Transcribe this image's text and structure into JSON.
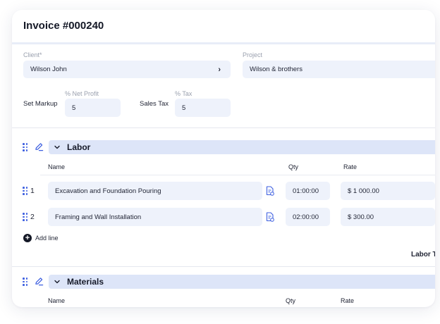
{
  "invoice": {
    "title": "Invoice #000240"
  },
  "client": {
    "label": "Client*",
    "value": "Wilson John"
  },
  "project": {
    "label": "Project",
    "value": "Wilson & brothers"
  },
  "markup": {
    "label": "Set Markup",
    "net_profit_label": "% Net Profit",
    "net_profit_value": "5"
  },
  "tax": {
    "label": "Sales Tax",
    "tax_label": "% Tax",
    "tax_value": "5"
  },
  "labor": {
    "title": "Labor",
    "columns": {
      "name": "Name",
      "qty": "Qty",
      "rate": "Rate"
    },
    "rows": [
      {
        "num": "1",
        "name": "Excavation and Foundation Pouring",
        "qty": "01:00:00",
        "rate": "$ 1 000.00"
      },
      {
        "num": "2",
        "name": "Framing and Wall Installation",
        "qty": "02:00:00",
        "rate": "$ 300.00"
      }
    ],
    "add_line": "Add line",
    "total_label": "Labor T"
  },
  "materials": {
    "title": "Materials",
    "columns": {
      "name": "Name",
      "qty": "Qty",
      "rate": "Rate"
    }
  },
  "colors": {
    "accent": "#3d5fe0",
    "field_bg": "#eef2fb",
    "section_bg": "#dde5f8"
  }
}
